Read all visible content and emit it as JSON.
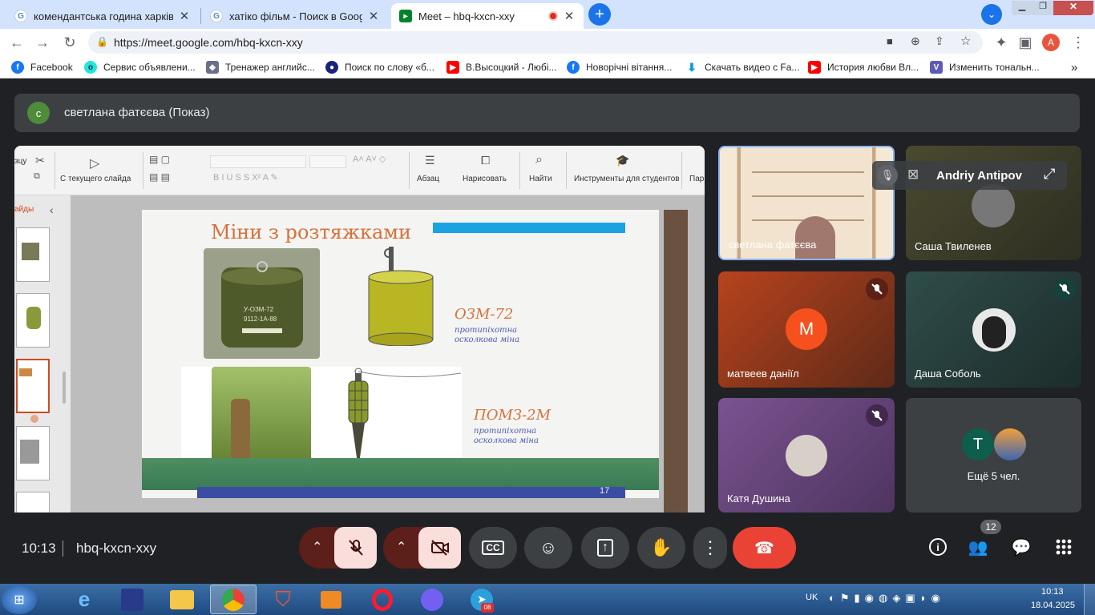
{
  "browser": {
    "tabs": [
      {
        "title": "комендантська година харківсь",
        "favicon": "google-g",
        "active": false
      },
      {
        "title": "хатіко фільм - Поиск в Google",
        "favicon": "google-g",
        "active": false
      },
      {
        "title": "Meet – hbq-kxcn-xxy",
        "favicon": "meet",
        "active": true
      }
    ],
    "new_tab_label": "+",
    "url": "https://meet.google.com/hbq-kxcn-xxy",
    "profile_initial": "A",
    "bookmarks": [
      {
        "label": "Facebook",
        "icon": "facebook"
      },
      {
        "label": "Сервис объявлени...",
        "icon": "olx"
      },
      {
        "label": "Тренажер английс...",
        "icon": "app"
      },
      {
        "label": "Поиск по слову «б...",
        "icon": "search"
      },
      {
        "label": "В.Высоцкий - Любі...",
        "icon": "youtube"
      },
      {
        "label": "Новорічні вітання...",
        "icon": "facebook"
      },
      {
        "label": "Скачать видео с Fa...",
        "icon": "download"
      },
      {
        "label": "История любви Вл...",
        "icon": "youtube"
      },
      {
        "label": "Изменить тональн...",
        "icon": "v"
      }
    ],
    "more_bookmarks": "»"
  },
  "meet": {
    "presenter": {
      "initial": "с",
      "text": "светлана фатєєва (Показ)"
    },
    "ribbon": {
      "labels": [
        "зцу",
        "С текущего слайда",
        "Абзац",
        "Нарисовать",
        "Найти",
        "Инструменты для студентов",
        "Пар"
      ],
      "thumbs_label": "айды"
    },
    "slide": {
      "title": "Міни з розтяжками",
      "mines": [
        {
          "name": "ОЗМ-72",
          "desc": "протипіхотна осколкова міна"
        },
        {
          "name": "ПОМЗ-2М",
          "desc": "протипіхотна осколкова міна"
        }
      ],
      "slide_number": "17",
      "photo_text_1": "У-ОЗМ-72",
      "photo_text_2": "9112-1А-88"
    },
    "participants": [
      {
        "name": "светлана фатєєва",
        "initial": "",
        "muted": false
      },
      {
        "name": "Саша Твиленев",
        "initial": "",
        "muted": false
      },
      {
        "name": "матвеев даніїл",
        "initial": "М",
        "muted": true
      },
      {
        "name": "Даша Соболь",
        "initial": "",
        "muted": true
      },
      {
        "name": "Катя Душина",
        "initial": "",
        "muted": true
      }
    ],
    "overlay_name": "Andriy Antipov",
    "more_people": {
      "initial": "Т",
      "label": "Ещё 5 чел."
    },
    "time": "10:13",
    "meeting_code": "hbq-kxcn-xxy",
    "people_count": "12",
    "colors": {
      "hangup": "#ea4335",
      "muted_bg": "#f9dedc",
      "accent": "#8ab4f8"
    }
  },
  "taskbar": {
    "lang": "UK",
    "time": "10:13",
    "date": "18.04.2025",
    "telegram_badge": "08"
  }
}
